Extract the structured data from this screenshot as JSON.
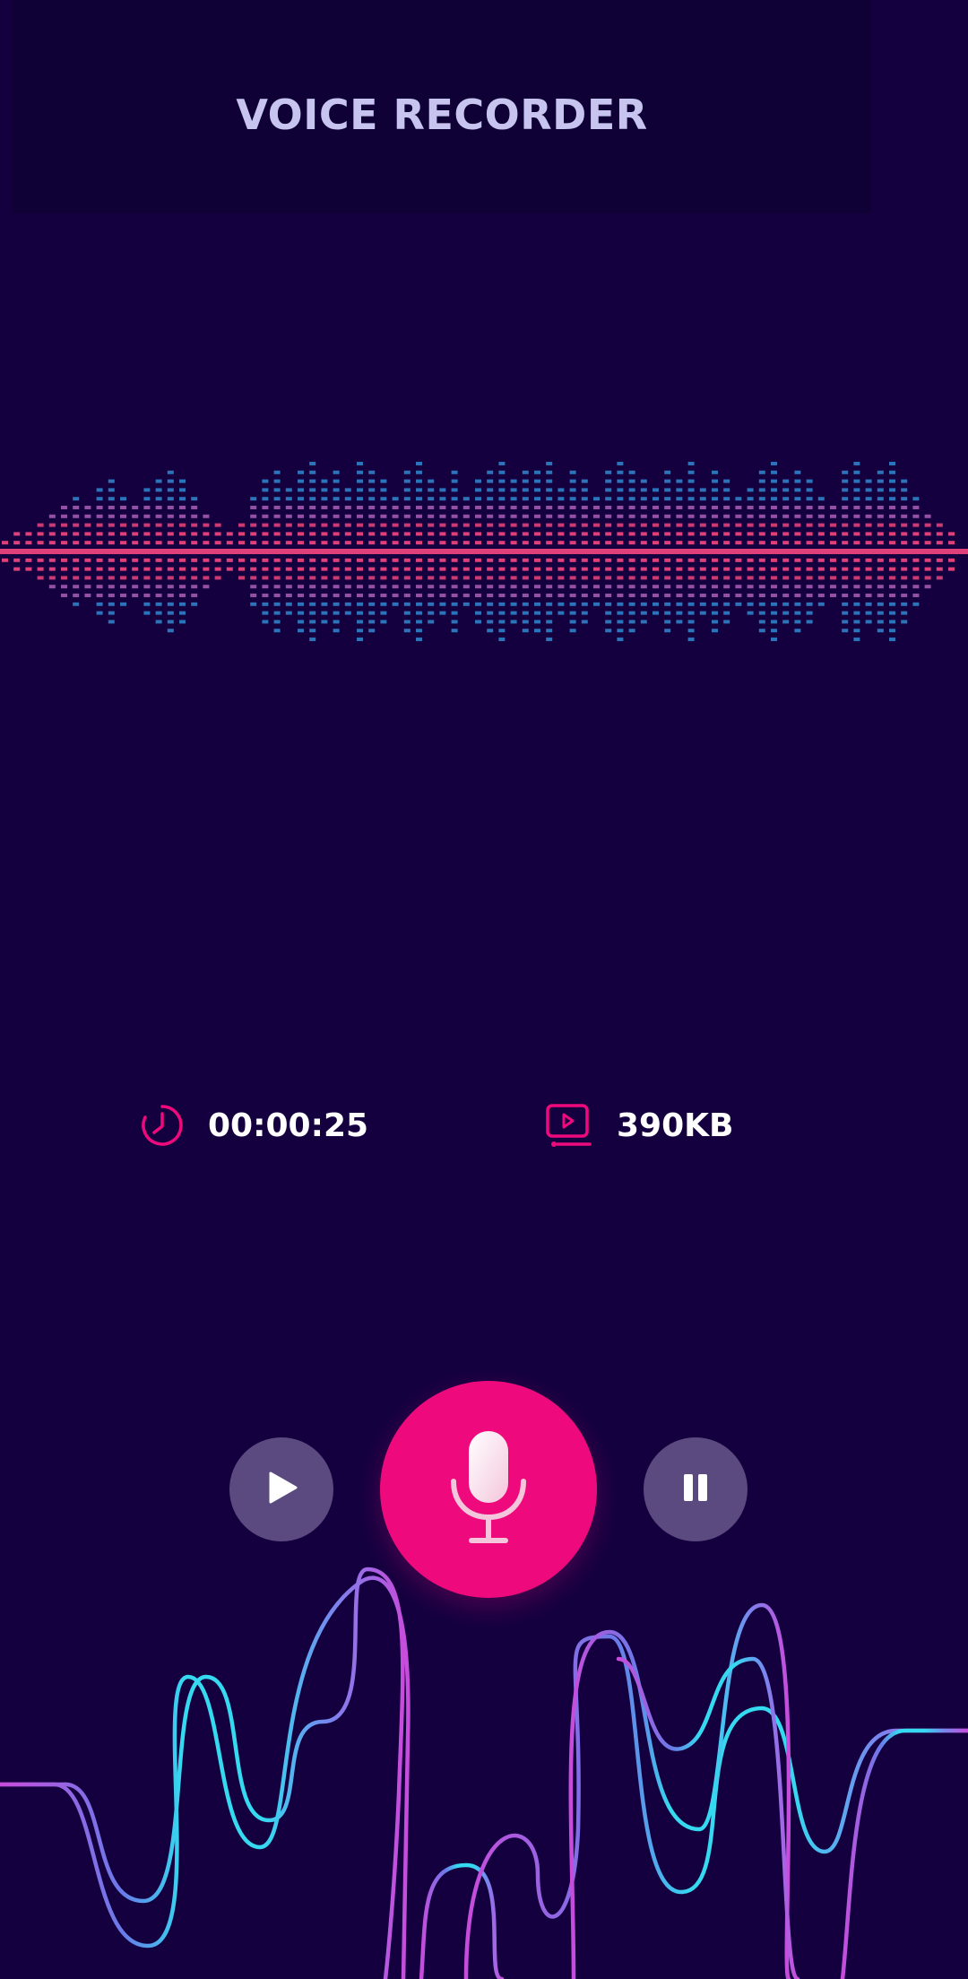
{
  "header": {
    "title": "VOICE RECORDER"
  },
  "stats": {
    "duration": "00:00:25",
    "file_size": "390KB"
  },
  "icons": {
    "duration": "clock-icon",
    "file_size": "video-file-icon",
    "play": "play-icon",
    "record": "microphone-icon",
    "pause": "pause-icon"
  },
  "colors": {
    "background": "#14003f",
    "header_background": "#0f0035",
    "accent": "#ee0a7d",
    "secondary_button": "#5a4a80",
    "equalizer_center": "#e0407a",
    "equalizer_edge": "#2f80c8",
    "wave_cyan": "#35d9f0",
    "wave_purple": "#b24fe0"
  }
}
